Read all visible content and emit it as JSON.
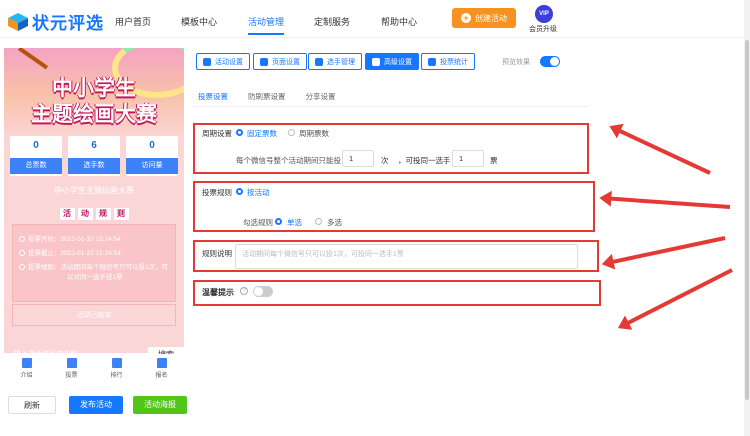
{
  "header": {
    "logo_text": "状元评选",
    "nav": [
      "用户首页",
      "模板中心",
      "活动管理",
      "定制服务",
      "帮助中心"
    ],
    "create_button": "创建活动",
    "vip_badge": "VIP",
    "vip_label": "会员升级"
  },
  "preview": {
    "banner_line1": "中小学生",
    "banner_line2": "主题绘画大赛",
    "stats": [
      {
        "value": "0",
        "label": "总票数"
      },
      {
        "value": "6",
        "label": "选手数"
      },
      {
        "value": "0",
        "label": "访问量"
      }
    ],
    "activity_title": "中小学生主题绘画大赛",
    "rules_chars": [
      "活",
      "动",
      "规",
      "则"
    ],
    "rules": [
      "投票开始：2021-01-10 15:24:54",
      "投票截止：2021-01-22 15:24:54",
      "投票规则：活动期间每个微信号只可以投1次，可",
      "以对同一选手投1票"
    ],
    "empty_text": "活动已结束",
    "search_placeholder": "输入选手编号或名称",
    "search_button": "搜索",
    "bottom_nav": [
      "介绍",
      "投票",
      "排行",
      "报名"
    ]
  },
  "footer_buttons": {
    "refresh": "刷新",
    "publish": "发布活动",
    "poster": "活动海报"
  },
  "toolbar": {
    "buttons": [
      "活动设置",
      "页面设置",
      "选手管理",
      "高级设置",
      "投票统计"
    ],
    "active_index": 3,
    "preview_label": "预览效果",
    "preview_on": true
  },
  "subtabs": [
    "投票设置",
    "防刷票设置",
    "分享设置"
  ],
  "settings": {
    "cycle_label": "周期设置",
    "cycle_options": [
      "固定票数",
      "周期票数"
    ],
    "votes_prefix": "每个微信号整个活动期间只能投",
    "votes_value": "1",
    "votes_unit": "次",
    "votes_mid": "，可投同一选手",
    "votes_per_player": "1",
    "votes_unit2": "票",
    "rule_label": "投票规则",
    "rule_option": "按活动",
    "select_label": "勾选规则",
    "select_options": [
      "单选",
      "多选"
    ],
    "desc_label": "规则说明",
    "desc_placeholder": "活动期间每个微信号只可以投1次，可投同一选手1票",
    "tip_label": "温馨提示",
    "tip_on": false
  },
  "colors": {
    "primary": "#1677ff",
    "highlight": "#e53935",
    "orange": "#f7921e",
    "green": "#52c41a"
  }
}
